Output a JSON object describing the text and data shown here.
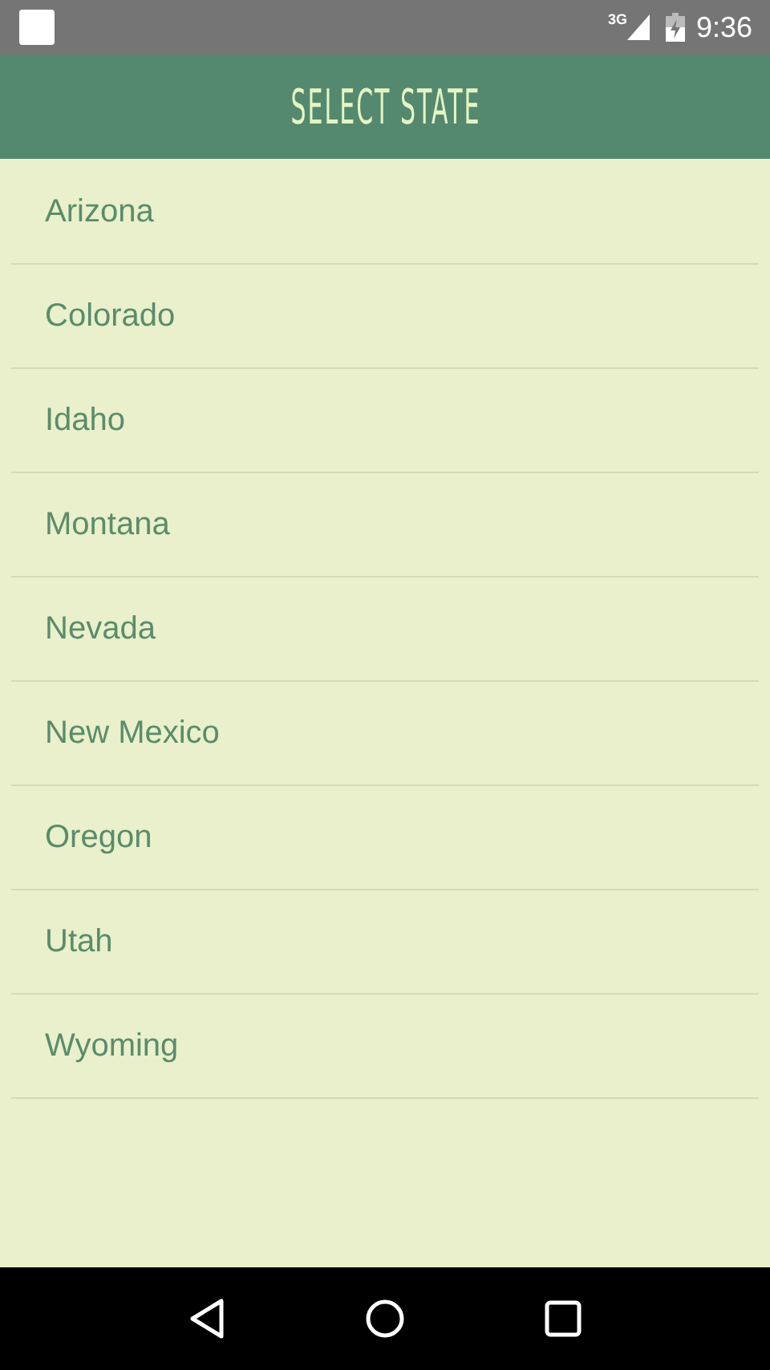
{
  "status_bar": {
    "network": "3G",
    "time": "9:36"
  },
  "app_bar": {
    "title": "SELECT STATE"
  },
  "states": [
    {
      "name": "Arizona"
    },
    {
      "name": "Colorado"
    },
    {
      "name": "Idaho"
    },
    {
      "name": "Montana"
    },
    {
      "name": "Nevada"
    },
    {
      "name": "New Mexico"
    },
    {
      "name": "Oregon"
    },
    {
      "name": "Utah"
    },
    {
      "name": "Wyoming"
    }
  ]
}
